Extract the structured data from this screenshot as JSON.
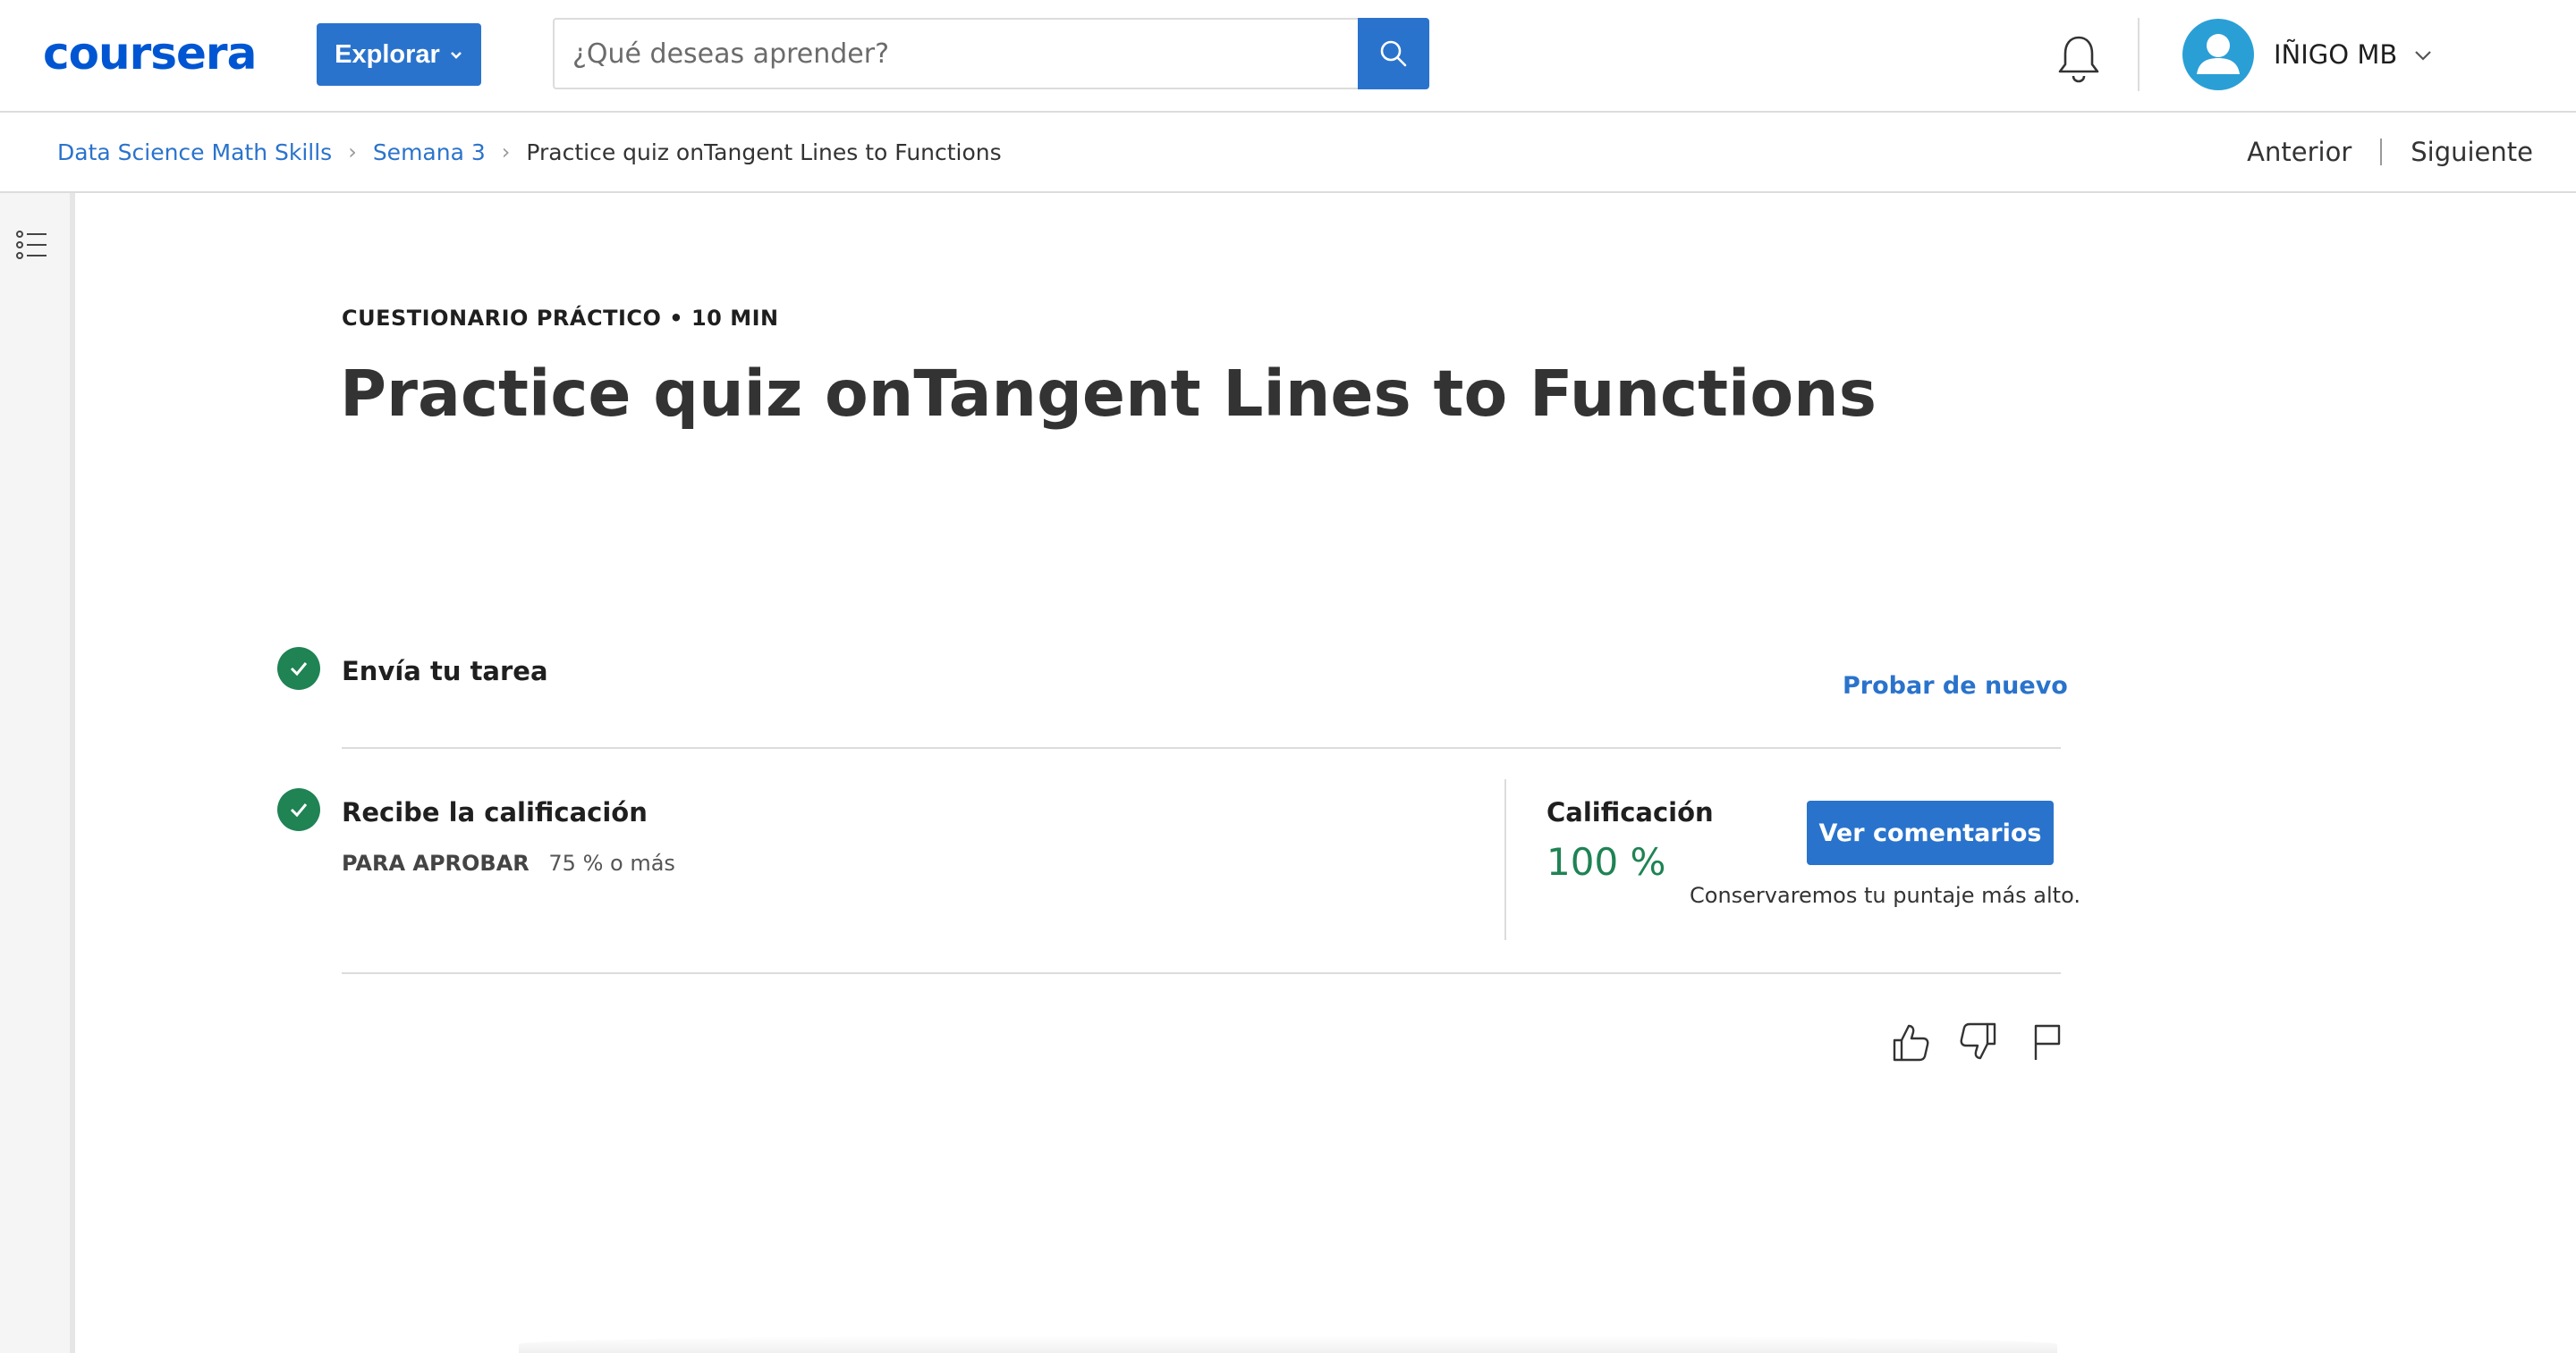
{
  "header": {
    "logo": "coursera",
    "explore_label": "Explorar",
    "search_placeholder": "¿Qué deseas aprender?",
    "user_name": "IÑIGO MB",
    "icons": [
      "search-icon",
      "bell-icon",
      "user-avatar-icon",
      "chevron-down-icon"
    ]
  },
  "breadcrumb": {
    "items": [
      "Data Science Math Skills",
      "Semana 3",
      "Practice quiz onTangent Lines to Functions"
    ]
  },
  "nav": {
    "previous": "Anterior",
    "next": "Siguiente"
  },
  "main": {
    "eyebrow": "CUESTIONARIO PRÁCTICO • 10 MIN",
    "title": "Practice quiz onTangent Lines to Functions",
    "submit_step": {
      "label": "Envía tu tarea",
      "action": "Probar de nuevo",
      "status": "complete"
    },
    "grade_step": {
      "label": "Recibe la calificación",
      "passing_caption": "PARA APROBAR",
      "passing_value": "75 % o más",
      "status": "complete"
    },
    "grade": {
      "label": "Calificación",
      "value": "100 %",
      "button": "Ver comentarios",
      "note": "Conservaremos tu puntaje más alto."
    },
    "feedback_icons": [
      "thumbs-up-icon",
      "thumbs-down-icon",
      "flag-icon"
    ]
  },
  "colors": {
    "brand": "#0056d2",
    "primary_button": "#2a73cc",
    "success": "#1f8354",
    "avatar": "#2a9fd6"
  }
}
